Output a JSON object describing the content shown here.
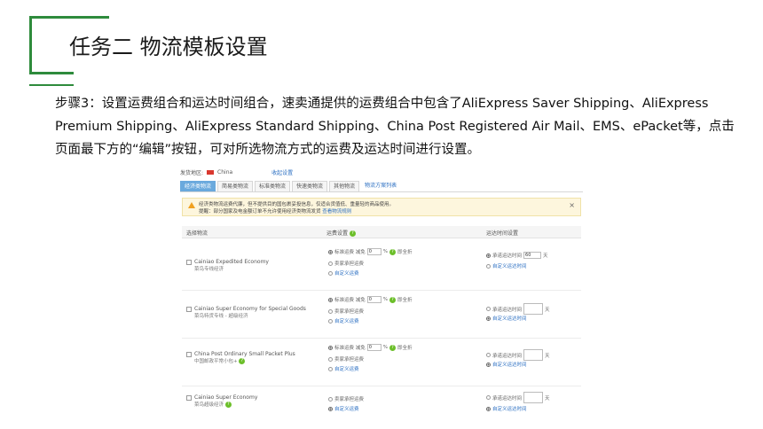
{
  "slide": {
    "title": "任务二 物流模板设置",
    "paragraph": "步骤3：设置运费组合和运达时间组合，速卖通提供的运费组合中包含了AliExpress Saver Shipping、AliExpress Premium Shipping、AliExpress Standard Shipping、China Post Registered Air Mail、EMS、ePacket等，点击页面最下方的“编辑”按钮，可对所选物流方式的运费及运达时间进行设置。"
  },
  "panel": {
    "origin_label": "发货地区:",
    "origin_value": "China",
    "origin_link": "收起设置",
    "tabs": [
      "经济类物流",
      "简易类物流",
      "标准类物流",
      "快速类物流",
      "其他物流"
    ],
    "tab_link": "物流方案列表",
    "notice_line1": "经济类物流运费代廉，但不提供目的国包裹妥投信息，仅适合货值低、重量轻的商品使用。",
    "notice_line2": "提醒：部分国家及电金额订单不允许使用经济类物流发货",
    "notice_link": "查看物流规则",
    "notice_close": "×",
    "headers": {
      "col1": "选择物流",
      "col2": "运费设置",
      "col3": "运达时间设置"
    },
    "rows": [
      {
        "name": "Cainiao Expedited Economy",
        "sub": "菜鸟专线经济",
        "fee_opts": [
          "标准运费 减免",
          "卖家承担运费",
          "自定义运费"
        ],
        "discount": "0",
        "percent": "%",
        "free_label": "即全折",
        "time_opts": [
          "承诺运达时间",
          "自定义运达时间"
        ],
        "days": "60",
        "days_unit": "天"
      },
      {
        "name": "Cainiao Super Economy for Special Goods",
        "sub": "菜鸟特货专线 - 超级经济",
        "fee_opts": [
          "标准运费 减免",
          "卖家承担运费",
          "自定义运费"
        ],
        "discount": "0",
        "percent": "%",
        "free_label": "即全折",
        "time_opts": [
          "承诺运达时间",
          "自定义运达时间"
        ],
        "days": "",
        "days_unit": "天"
      },
      {
        "name": "China Post Ordinary Small Packet Plus",
        "sub": "中国邮政平常小包+",
        "fee_opts": [
          "标准运费 减免",
          "卖家承担运费",
          "自定义运费"
        ],
        "discount": "0",
        "percent": "%",
        "free_label": "即全折",
        "time_opts": [
          "承诺运达时间",
          "自定义运达时间"
        ],
        "days": "",
        "days_unit": "天"
      },
      {
        "name": "Cainiao Super Economy",
        "sub": "菜鸟超级经济",
        "fee_opts": [
          "卖家承担运费",
          "自定义运费"
        ],
        "time_opts": [
          "承诺运达时间",
          "自定义运达时间"
        ],
        "days": "",
        "days_unit": "天"
      }
    ]
  },
  "colors": {
    "frame": "#2e8b3c",
    "tab_active": "#6aa9dd",
    "link": "#2b6fc2",
    "notice_bg": "#fdf6dd"
  }
}
